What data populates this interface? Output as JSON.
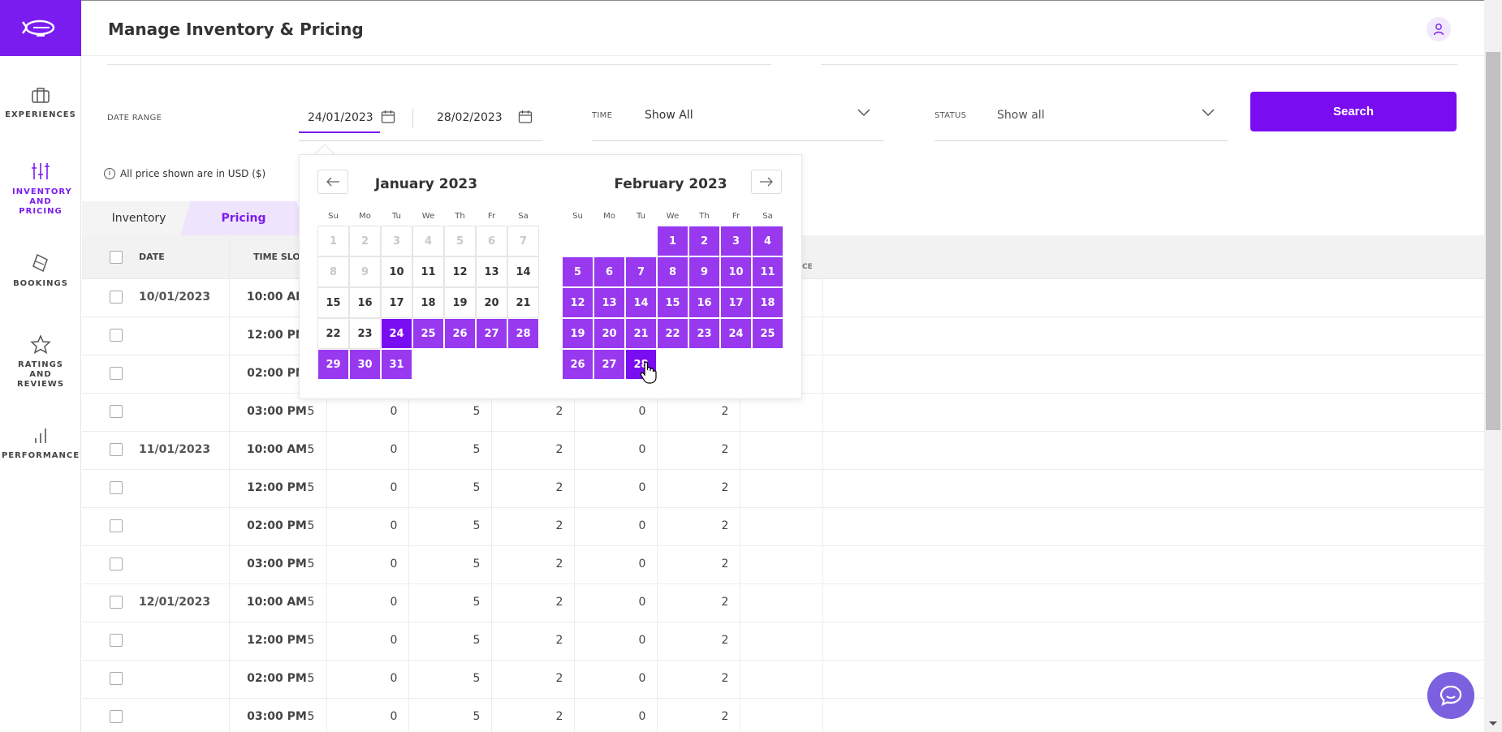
{
  "header": {
    "title": "Manage Inventory & Pricing"
  },
  "sidebar": {
    "items": [
      {
        "label": "EXPERIENCES",
        "icon": "briefcase-icon"
      },
      {
        "label": "INVENTORY AND PRICING",
        "icon": "sliders-icon",
        "active": true
      },
      {
        "label": "BOOKINGS",
        "icon": "ticket-icon"
      },
      {
        "label": "RATINGS AND REVIEWS",
        "icon": "star-icon"
      },
      {
        "label": "PERFORMANCE",
        "icon": "bar-chart-icon"
      }
    ]
  },
  "filters": {
    "date_range_label": "DATE RANGE",
    "start_date": "24/01/2023",
    "end_date": "28/02/2023",
    "time_label": "TIME",
    "time_value": "Show All",
    "status_label": "STATUS",
    "status_value": "Show all",
    "search_label": "Search"
  },
  "usd_note": "All price shown are in USD ($)",
  "tabs": [
    {
      "label": "Inventory"
    },
    {
      "label": "Pricing",
      "active": true
    }
  ],
  "table": {
    "headers": {
      "date": "DATE",
      "time": "TIME SLOT",
      "extra": "CE"
    },
    "rows": [
      {
        "date": "10/01/2023",
        "time": "10:00 AM",
        "values": []
      },
      {
        "date": "",
        "time": "12:00 PM",
        "values": []
      },
      {
        "date": "",
        "time": "02:00 PM",
        "values": []
      },
      {
        "date": "",
        "time": "03:00 PM",
        "values": [
          "5",
          "0",
          "5",
          "2",
          "0",
          "2"
        ]
      },
      {
        "date": "11/01/2023",
        "time": "10:00 AM",
        "values": [
          "5",
          "0",
          "5",
          "2",
          "0",
          "2"
        ]
      },
      {
        "date": "",
        "time": "12:00 PM",
        "values": [
          "5",
          "0",
          "5",
          "2",
          "0",
          "2"
        ]
      },
      {
        "date": "",
        "time": "02:00 PM",
        "values": [
          "5",
          "0",
          "5",
          "2",
          "0",
          "2"
        ]
      },
      {
        "date": "",
        "time": "03:00 PM",
        "values": [
          "5",
          "0",
          "5",
          "2",
          "0",
          "2"
        ]
      },
      {
        "date": "12/01/2023",
        "time": "10:00 AM",
        "values": [
          "5",
          "0",
          "5",
          "2",
          "0",
          "2"
        ]
      },
      {
        "date": "",
        "time": "12:00 PM",
        "values": [
          "5",
          "0",
          "5",
          "2",
          "0",
          "2"
        ]
      },
      {
        "date": "",
        "time": "02:00 PM",
        "values": [
          "5",
          "0",
          "5",
          "2",
          "0",
          "2"
        ]
      },
      {
        "date": "",
        "time": "03:00 PM",
        "values": [
          "5",
          "0",
          "5",
          "2",
          "0",
          "2"
        ]
      }
    ]
  },
  "calendar": {
    "weekdays": [
      "Su",
      "Mo",
      "Tu",
      "We",
      "Th",
      "Fr",
      "Sa"
    ],
    "months": [
      {
        "title": "January 2023",
        "first_weekday": 0,
        "days": 31,
        "disabled_until": 9,
        "range_start": 24,
        "range_end": 31,
        "selected": [
          24
        ]
      },
      {
        "title": "February 2023",
        "first_weekday": 3,
        "days": 28,
        "disabled_until": 0,
        "range_start": 1,
        "range_end": 28,
        "selected": [
          28
        ]
      }
    ]
  },
  "colors": {
    "accent": "#7a0cf2",
    "range": "#9839ef",
    "chat": "#7b61e0"
  }
}
